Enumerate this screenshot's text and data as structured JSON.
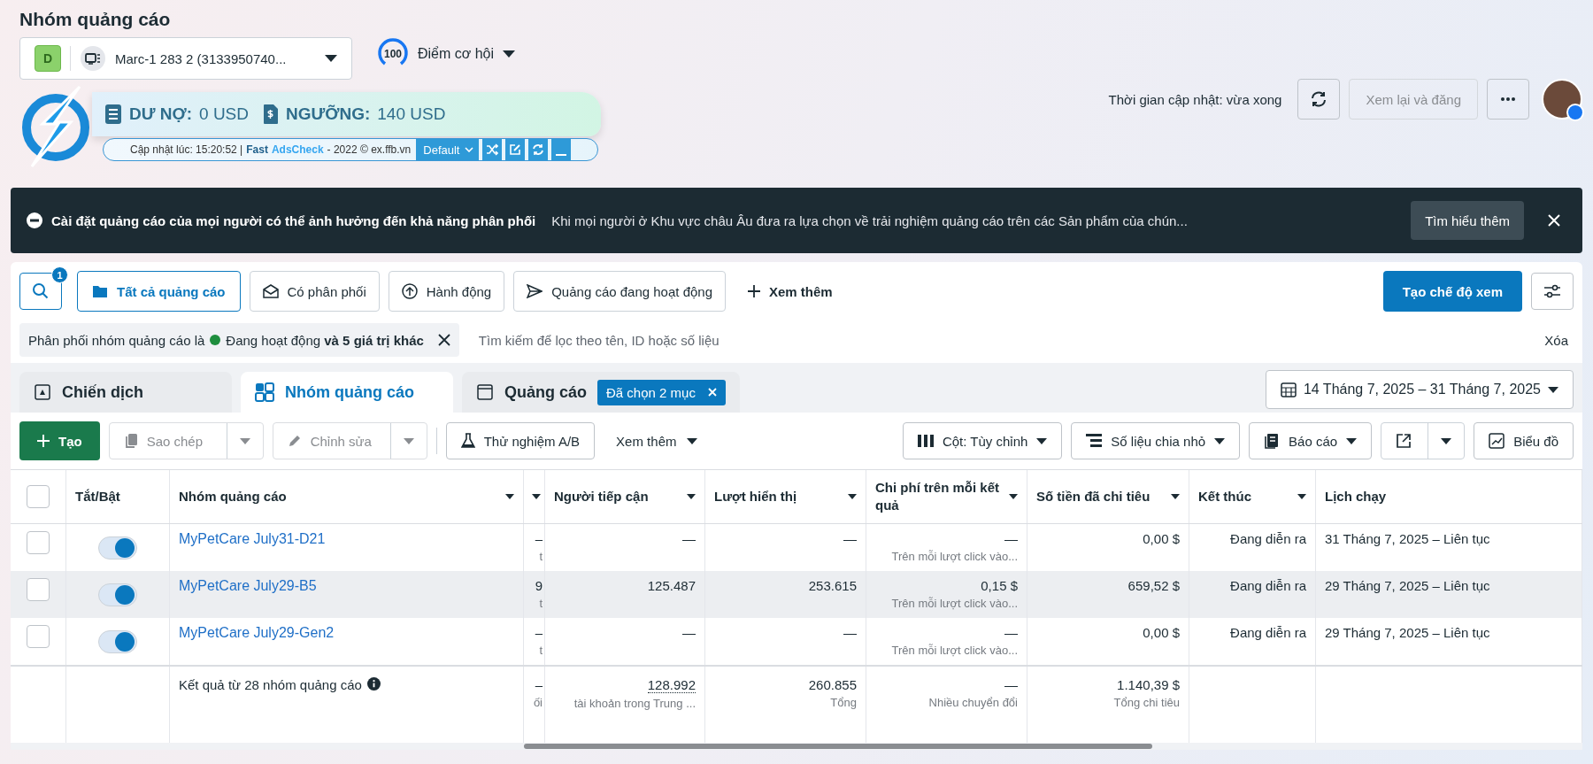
{
  "header": {
    "title": "Nhóm quảng cáo",
    "account": {
      "badge": "D",
      "name": "Marc-1 283 2 (3133950740..."
    },
    "score": {
      "value": "100",
      "label": "Điểm cơ hội"
    },
    "update_text": "Thời gian cập nhật: vừa xong",
    "review_button": {
      "label": "Xem lại và đăng",
      "disabled": true
    }
  },
  "extension": {
    "debt_label": "DƯ NỢ:",
    "debt_value": "0 USD",
    "limit_label": "NGƯỠNG:",
    "limit_value": "140 USD",
    "updated": "Cập nhật lúc: 15:20:52 |",
    "brand_a": "Fast",
    "brand_b": "AdsCheck",
    "footer": "- 2022 © ex.ffb.vn",
    "profile": "Default"
  },
  "banner": {
    "title": "Cài đặt quảng cáo của mọi người có thể ảnh hưởng đến khả năng phân phối",
    "text": "Khi mọi người ở Khu vực châu Âu đưa ra lựa chọn về trải nghiệm quảng cáo trên các Sản phẩm của chún...",
    "button": "Tìm hiểu thêm"
  },
  "search_badge": "1",
  "filters": [
    {
      "label": "Tất cả quảng cáo",
      "kind": "folder",
      "selected": true
    },
    {
      "label": "Có phân phối",
      "kind": "mail",
      "selected": false
    },
    {
      "label": "Hành động",
      "kind": "up",
      "selected": false
    },
    {
      "label": "Quảng cáo đang hoạt động",
      "kind": "send",
      "selected": false
    },
    {
      "label": "Xem thêm",
      "kind": "plus",
      "selected": false
    }
  ],
  "create_view": "Tạo chế độ xem",
  "filter_chip": {
    "prefix": "Phân phối nhóm quảng cáo là",
    "color": "#1e8e3e",
    "value": "Đang hoạt động **và 5 giá trị khác**"
  },
  "search_placeholder": "Tìm kiếm để lọc theo tên, ID hoặc số liệu",
  "clear": "Xóa",
  "tabs": [
    {
      "label": "Chiến dịch",
      "kind": "campaign",
      "selected": false
    },
    {
      "label": "Nhóm quảng cáo",
      "kind": "adset",
      "selected": true
    },
    {
      "label": "Quảng cáo",
      "kind": "ad",
      "selected": false,
      "badge": "Đã chọn 2 mục"
    }
  ],
  "date_range": "14 Tháng 7, 2025 – 31 Tháng 7, 2025",
  "actions": {
    "create": "Tạo",
    "copy": {
      "label": "Sao chép",
      "disabled": true
    },
    "edit": {
      "label": "Chỉnh sửa",
      "disabled": true
    },
    "ab_test": "Thử nghiệm A/B",
    "more": "Xem thêm",
    "columns": "Cột: Tùy chỉnh",
    "breakdown": "Số liệu chia nhỏ",
    "reports": "Báo cáo",
    "chart": "Biểu đồ"
  },
  "table": {
    "header_checked": false,
    "columns": [
      {
        "label": "Tắt/Bật",
        "menu": false
      },
      {
        "label": "Nhóm quảng cáo",
        "menu": true
      },
      {
        "menu": true
      },
      {
        "label": "Người tiếp cận",
        "menu": true
      },
      {
        "label": "Lượt hiển thị",
        "menu": true
      },
      {
        "label": "Chi phí trên mỗi kết quả",
        "menu": true
      },
      {
        "label": "Số tiền đã chi tiêu",
        "menu": true
      },
      {
        "label": "Kết thúc",
        "menu": true
      },
      {
        "label": "Lịch chạy",
        "menu": false
      }
    ],
    "rows": [
      {
        "checked": false,
        "on": true,
        "highlighted": false,
        "name": "MyPetCare July31-D21",
        "column_3": "–",
        "column_3_sub": "t",
        "reach": "—",
        "impressions": "—",
        "cost": "—",
        "cost_sub": "Trên mỗi lượt click vào...",
        "spent": "0,00 $",
        "end": "Đang diễn ra",
        "schedule": "31 Tháng 7, 2025 – Liên tục"
      },
      {
        "checked": false,
        "on": true,
        "highlighted": true,
        "name": "MyPetCare July29-B5",
        "column_3": "9",
        "column_3_sub": "t",
        "reach": "125.487",
        "impressions": "253.615",
        "cost": "0,15 $",
        "cost_sub": "Trên mỗi lượt click vào...",
        "spent": "659,52 $",
        "end": "Đang diễn ra",
        "schedule": "29 Tháng 7, 2025 – Liên tục"
      },
      {
        "checked": false,
        "on": true,
        "highlighted": false,
        "name": "MyPetCare July29-Gen2",
        "column_3": "–",
        "column_3_sub": "t",
        "reach": "—",
        "impressions": "—",
        "cost": "—",
        "cost_sub": "Trên mỗi lượt click vào...",
        "spent": "0,00 $",
        "end": "Đang diễn ra",
        "schedule": "29 Tháng 7, 2025 – Liên tục"
      }
    ],
    "summary": {
      "label": "Kết quả từ 28 nhóm quảng cáo",
      "column_3": "–",
      "column_3_sub": "ối",
      "reach": "128.992",
      "reach_sub": "tài khoản trong Trung ...",
      "impressions": "260.855",
      "impressions_sub": "Tổng",
      "cost": "—",
      "cost_sub": "Nhiều chuyển đổi",
      "spent": "1.140,39 $",
      "spent_sub": "Tổng chi tiêu"
    }
  }
}
